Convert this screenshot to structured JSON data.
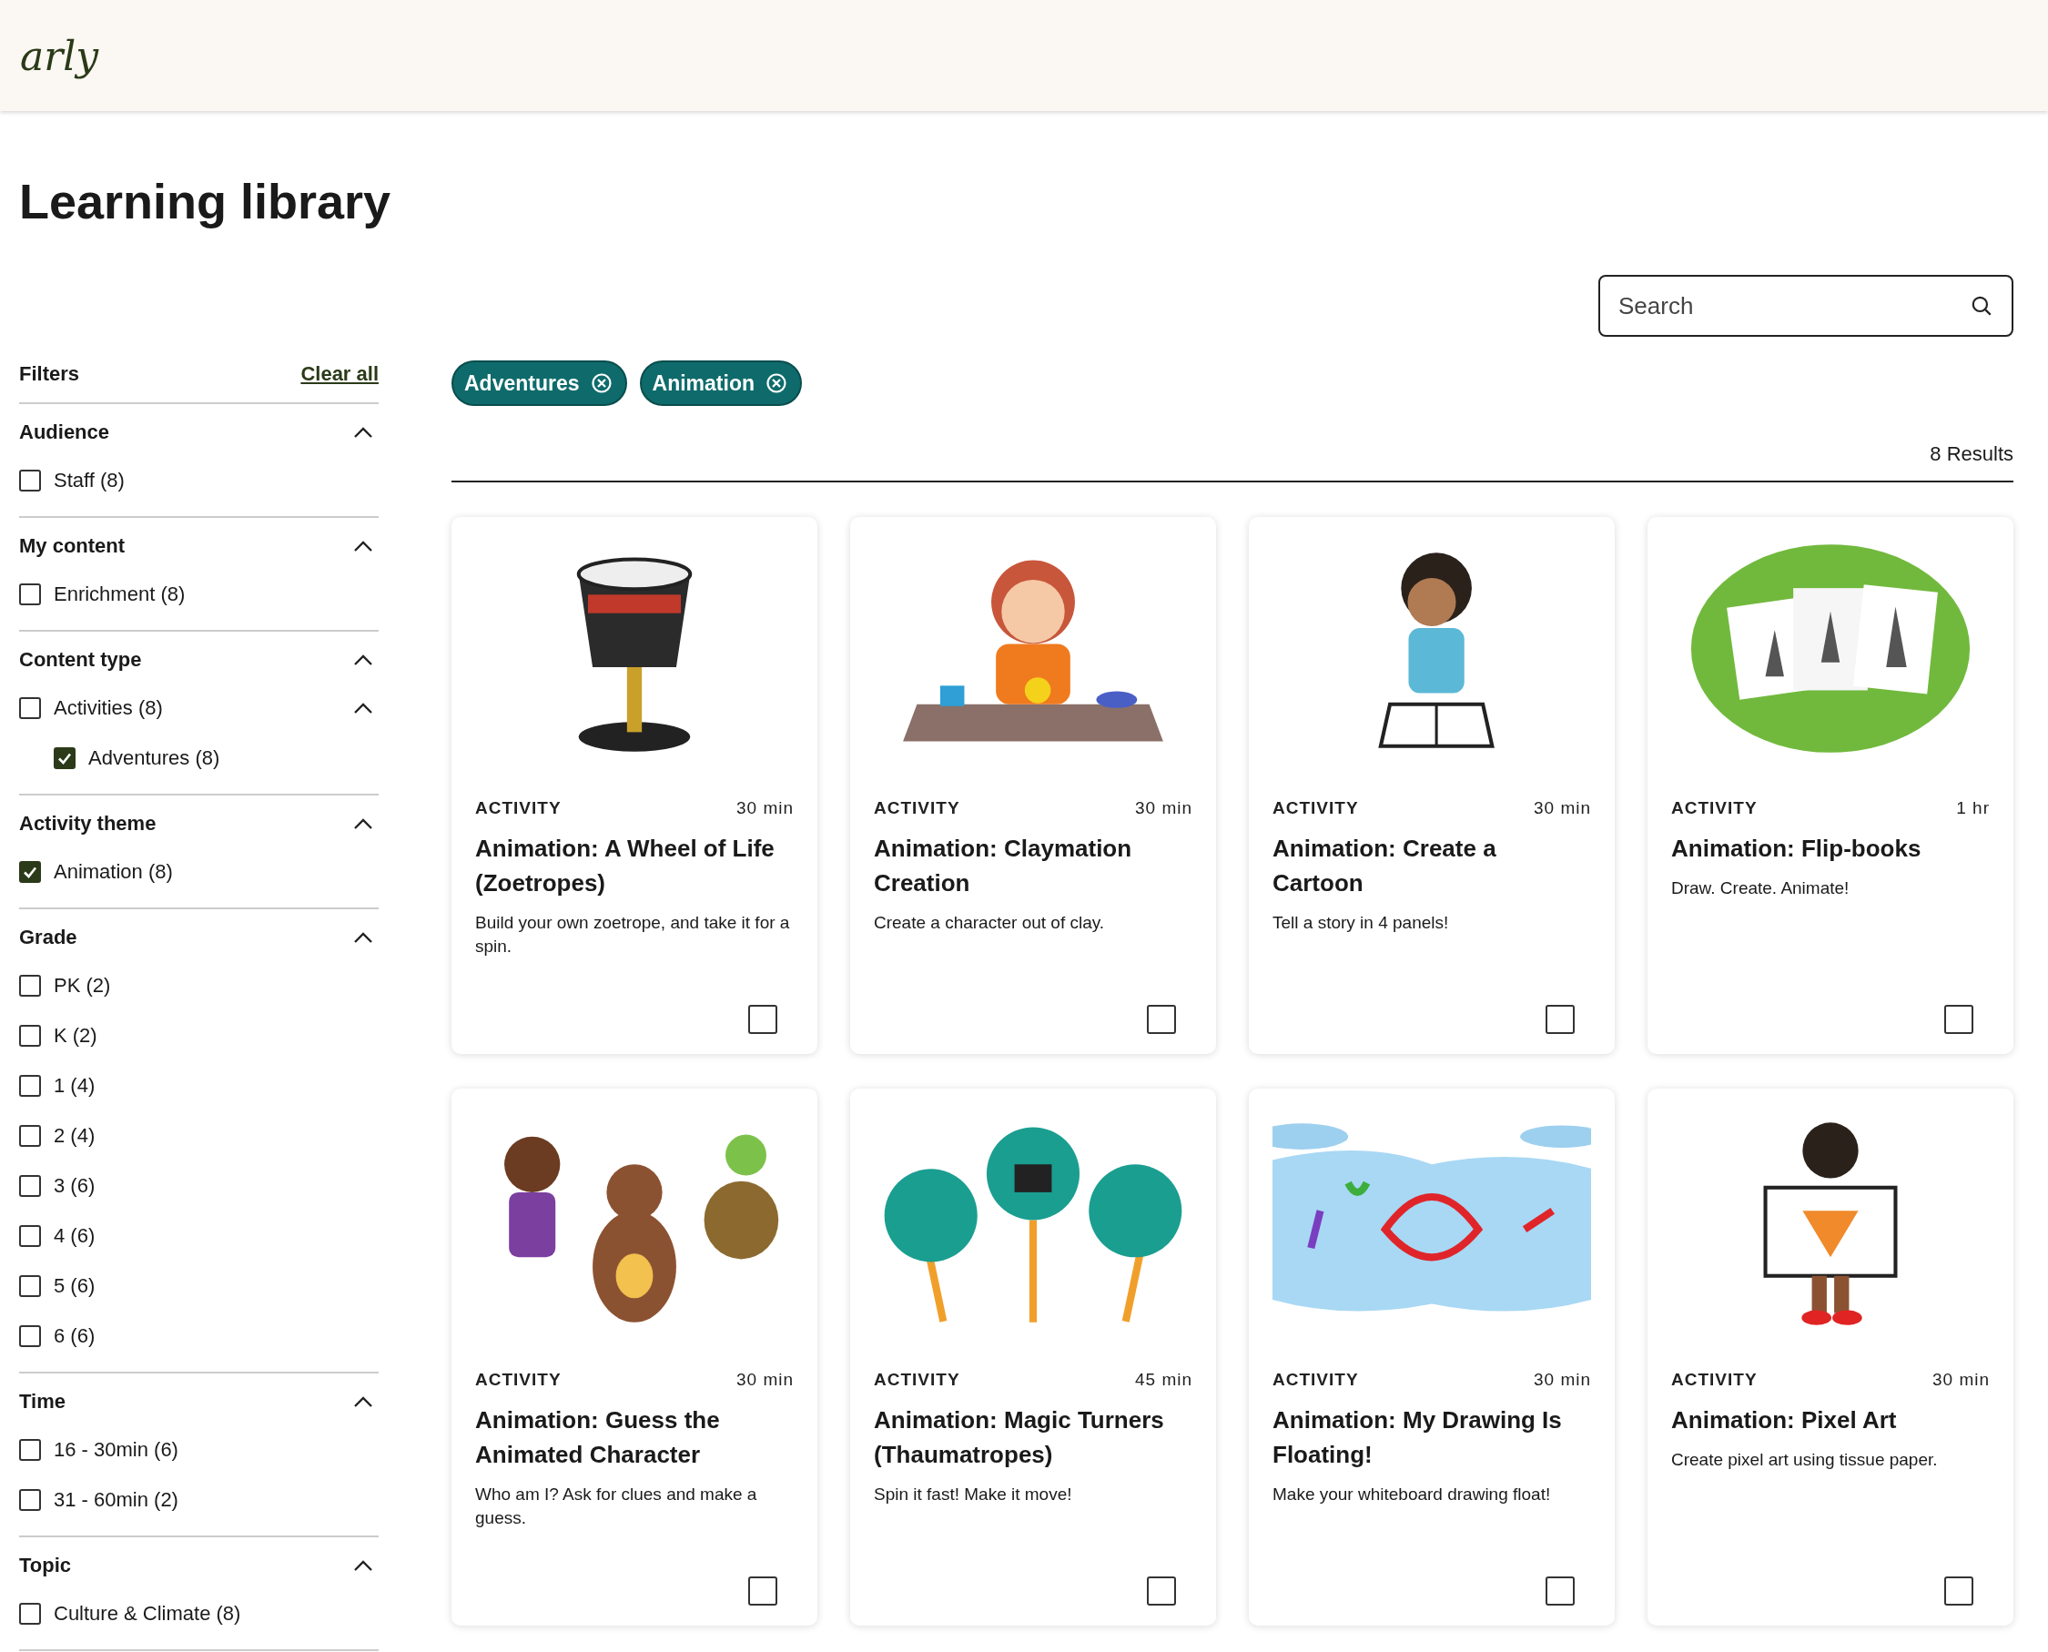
{
  "header": {
    "logo": "arly"
  },
  "title": "Learning library",
  "search": {
    "placeholder": "Search"
  },
  "filters": {
    "heading": "Filters",
    "clear": "Clear all",
    "groups": [
      {
        "title": "Audience",
        "expanded": true,
        "items": [
          {
            "label": "Staff (8)",
            "checked": false
          }
        ]
      },
      {
        "title": "My content",
        "expanded": true,
        "items": [
          {
            "label": "Enrichment (8)",
            "checked": false
          }
        ]
      },
      {
        "title": "Content type",
        "expanded": true,
        "items": [
          {
            "label": "Activities (8)",
            "checked": false,
            "expanded": true,
            "children": [
              {
                "label": "Adventures (8)",
                "checked": true
              }
            ]
          }
        ]
      },
      {
        "title": "Activity theme",
        "expanded": true,
        "items": [
          {
            "label": "Animation (8)",
            "checked": true
          }
        ]
      },
      {
        "title": "Grade",
        "expanded": true,
        "items": [
          {
            "label": "PK (2)",
            "checked": false
          },
          {
            "label": "K (2)",
            "checked": false
          },
          {
            "label": "1 (4)",
            "checked": false
          },
          {
            "label": "2 (4)",
            "checked": false
          },
          {
            "label": "3 (6)",
            "checked": false
          },
          {
            "label": "4 (6)",
            "checked": false
          },
          {
            "label": "5 (6)",
            "checked": false
          },
          {
            "label": "6 (6)",
            "checked": false
          }
        ]
      },
      {
        "title": "Time",
        "expanded": true,
        "items": [
          {
            "label": "16 - 30min (6)",
            "checked": false
          },
          {
            "label": "31 - 60min (2)",
            "checked": false
          }
        ]
      },
      {
        "title": "Topic",
        "expanded": true,
        "items": [
          {
            "label": "Culture & Climate (8)",
            "checked": false
          }
        ]
      }
    ]
  },
  "chips": [
    "Adventures",
    "Animation"
  ],
  "results": "8 Results",
  "cards": [
    {
      "type": "ACTIVITY",
      "duration": "30 min",
      "title": "Animation: A Wheel of Life (Zoetropes)",
      "description": "Build your own zoetrope, and take it for a spin.",
      "checked": false
    },
    {
      "type": "ACTIVITY",
      "duration": "30 min",
      "title": "Animation: Claymation Creation",
      "description": "Create a character out of clay.",
      "checked": false
    },
    {
      "type": "ACTIVITY",
      "duration": "30 min",
      "title": "Animation: Create a Cartoon",
      "description": "Tell a story in 4 panels!",
      "checked": false
    },
    {
      "type": "ACTIVITY",
      "duration": "1 hr",
      "title": "Animation: Flip-books",
      "description": "Draw. Create. Animate!",
      "checked": false
    },
    {
      "type": "ACTIVITY",
      "duration": "30 min",
      "title": "Animation: Guess the Animated Character",
      "description": "Who am I? Ask for clues and make a guess.",
      "checked": false
    },
    {
      "type": "ACTIVITY",
      "duration": "45 min",
      "title": "Animation: Magic Turners (Thaumatropes)",
      "description": "Spin it fast! Make it move!",
      "checked": false
    },
    {
      "type": "ACTIVITY",
      "duration": "30 min",
      "title": "Animation: My Drawing Is Floating!",
      "description": "Make your whiteboard drawing float!",
      "checked": false
    },
    {
      "type": "ACTIVITY",
      "duration": "30 min",
      "title": "Animation: Pixel Art",
      "description": "Create pixel art using tissue paper.",
      "checked": false
    }
  ]
}
